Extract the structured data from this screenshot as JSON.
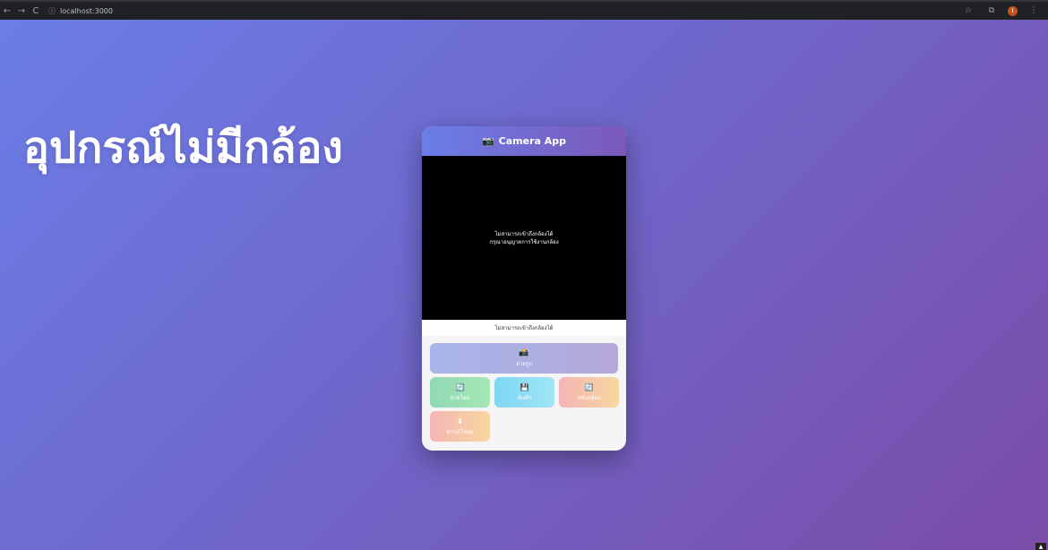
{
  "browser": {
    "url": "localhost:3000",
    "back_icon": "←",
    "forward_icon": "→",
    "reload_icon": "C",
    "site_icon": "ⓘ",
    "star_icon": "☆",
    "extension_icon": "⧉",
    "profile_initial": "I"
  },
  "hero": {
    "title": "อุปกรณ์ไม่มีกล้อง"
  },
  "app": {
    "header_icon": "📷",
    "header_title": "Camera App",
    "video_message_line1": "ไม่สามารถเข้าถึงกล้องได้",
    "video_message_line2": "กรุณาอนุญาตการใช้งานกล้อง",
    "status_text": "ไม่สามารถเข้าถึงกล้องได้",
    "capture_icon": "📸",
    "capture_label": "ถ่ายรูป",
    "buttons": [
      {
        "icon": "🔄",
        "label": "ถ่ายใหม่"
      },
      {
        "icon": "💾",
        "label": "บันทึก"
      },
      {
        "icon": "🔄",
        "label": "สลับกล้อง"
      },
      {
        "icon": "⬇",
        "label": "ดาวน์โหลด"
      }
    ]
  },
  "colors": {
    "background_start": "#6b7ee8",
    "background_end": "#7b4ca8",
    "header_start": "#6b7ee8",
    "header_end": "#7b58b9"
  }
}
